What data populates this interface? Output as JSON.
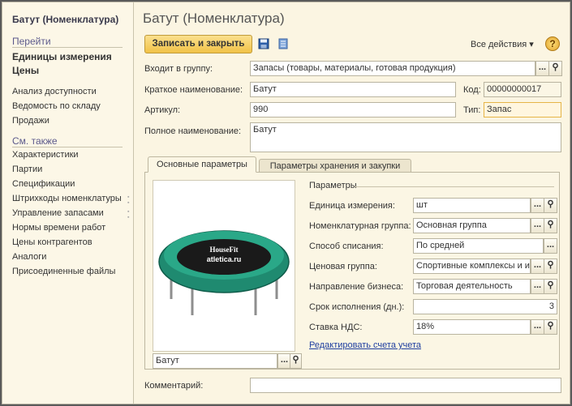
{
  "sidebar": {
    "title": "Батут (Номенклатура)",
    "goto_header": "Перейти",
    "goto_items": [
      "Единицы измерения",
      "Цены"
    ],
    "links": [
      "Анализ доступности",
      "Ведомость по складу",
      "Продажи"
    ],
    "see_also_header": "См. также",
    "see_also": [
      "Характеристики",
      "Партии",
      "Спецификации",
      "Штрихкоды номенклатуры",
      "Управление запасами",
      "Нормы времени работ",
      "Цены контрагентов",
      "Аналоги",
      "Присоединенные файлы"
    ]
  },
  "header": {
    "title": "Батут (Номенклатура)"
  },
  "toolbar": {
    "save_close": "Записать и закрыть",
    "all_actions": "Все действия ▾",
    "help": "?"
  },
  "form": {
    "group_label": "Входит в группу:",
    "group_value": "Запасы (товары, материалы, готовая продукция)",
    "short_label": "Краткое наименование:",
    "short_value": "Батут",
    "code_label": "Код:",
    "code_value": "00000000017",
    "art_label": "Артикул:",
    "art_value": "990",
    "type_label": "Тип:",
    "type_value": "Запас",
    "full_label": "Полное наименование:",
    "full_value": "Батут",
    "comment_label": "Комментарий:",
    "comment_value": ""
  },
  "tabs": [
    "Основные параметры",
    "Параметры хранения и закупки"
  ],
  "image": {
    "caption": "Батут",
    "brand": "HouseFit",
    "site": "atletica.ru"
  },
  "params": {
    "header": "Параметры",
    "unit_label": "Единица измерения:",
    "unit_value": "шт",
    "nomgroup_label": "Номенклатурная группа:",
    "nomgroup_value": "Основная группа",
    "writeoff_label": "Способ списания:",
    "writeoff_value": "По средней",
    "pricegroup_label": "Ценовая группа:",
    "pricegroup_value": "Спортивные комплексы и и",
    "biz_label": "Направление бизнеса:",
    "biz_value": "Торговая деятельность",
    "days_label": "Срок исполнения (дн.):",
    "days_value": "3",
    "vat_label": "Ставка НДС:",
    "vat_value": "18%",
    "edit_link": "Редактировать счета учета"
  },
  "icons": {
    "save": "floppy-icon",
    "list": "list-icon",
    "select": "ellipsis-icon",
    "search": "magnifier-icon"
  },
  "colors": {
    "accent_button": "#f1c247",
    "link": "#1f3fa0",
    "section": "#5c5a8c"
  }
}
